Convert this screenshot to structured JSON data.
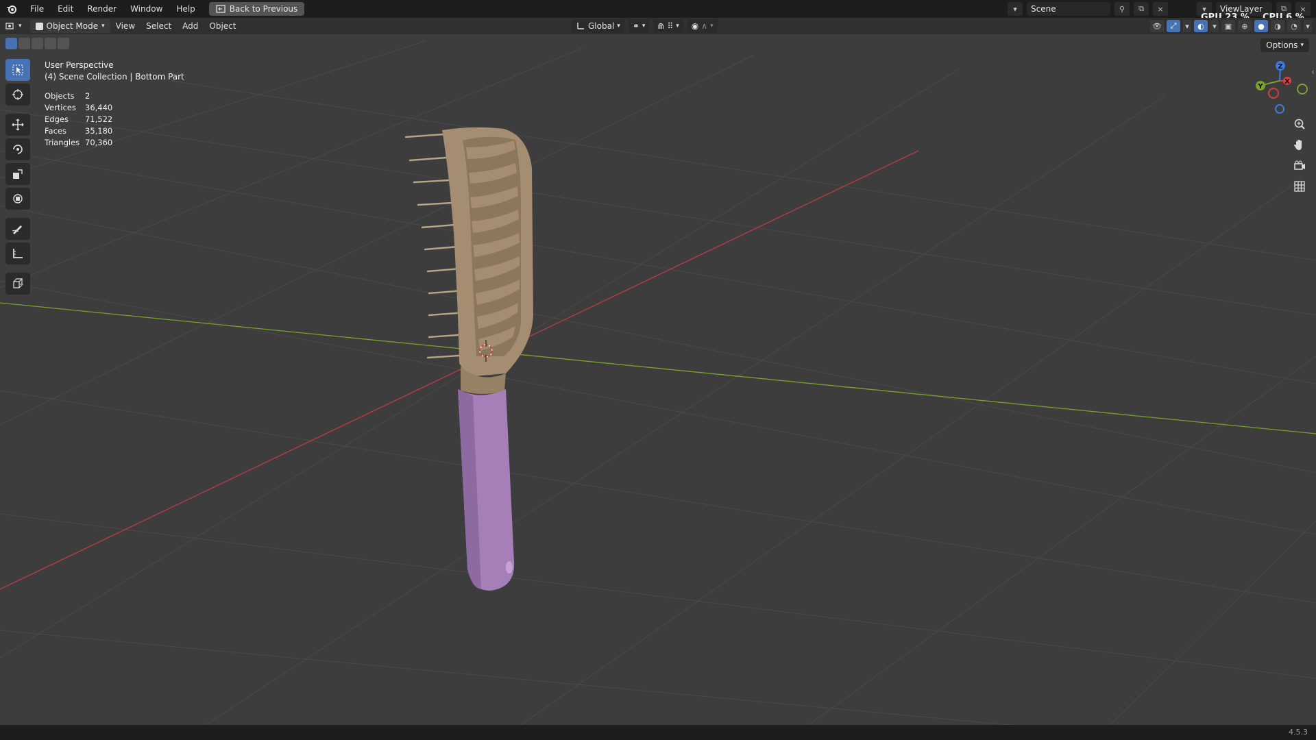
{
  "menu": {
    "items": [
      "File",
      "Edit",
      "Render",
      "Window",
      "Help"
    ],
    "back_button": "Back to Previous"
  },
  "topright": {
    "scene": "Scene",
    "view_layer": "ViewLayer",
    "gpu_label": "GPU",
    "gpu_value": "23 %",
    "cpu_label": "CPU",
    "cpu_value": "6 %"
  },
  "header": {
    "mode": "Object Mode",
    "menus": [
      "View",
      "Select",
      "Add",
      "Object"
    ],
    "transform_orientation": "Global",
    "options_label": "Options"
  },
  "viewport": {
    "perspective": "User Perspective",
    "collection": "(4) Scene Collection | Bottom Part"
  },
  "stats": [
    {
      "label": "Objects",
      "value": "2"
    },
    {
      "label": "Vertices",
      "value": "36,440"
    },
    {
      "label": "Edges",
      "value": "71,522"
    },
    {
      "label": "Faces",
      "value": "35,180"
    },
    {
      "label": "Triangles",
      "value": "70,360"
    }
  ],
  "gizmo": {
    "x": "X",
    "y": "Y",
    "z": "Z"
  },
  "status": {
    "version": "4.5.3"
  },
  "icons": {
    "tools": [
      "select-box-icon",
      "cursor-icon",
      "move-icon",
      "rotate-icon",
      "scale-icon",
      "transform-icon",
      "annotate-icon",
      "measure-icon",
      "add-cube-icon"
    ],
    "nav": [
      "zoom-icon",
      "pan-hand-icon",
      "camera-icon",
      "grid-icon"
    ]
  },
  "colors": {
    "accent": "#4772b3",
    "x_axis": "#c03a4a",
    "y_axis": "#7aa32a",
    "comb": "#a48d70",
    "handle": "#a67fb9"
  }
}
